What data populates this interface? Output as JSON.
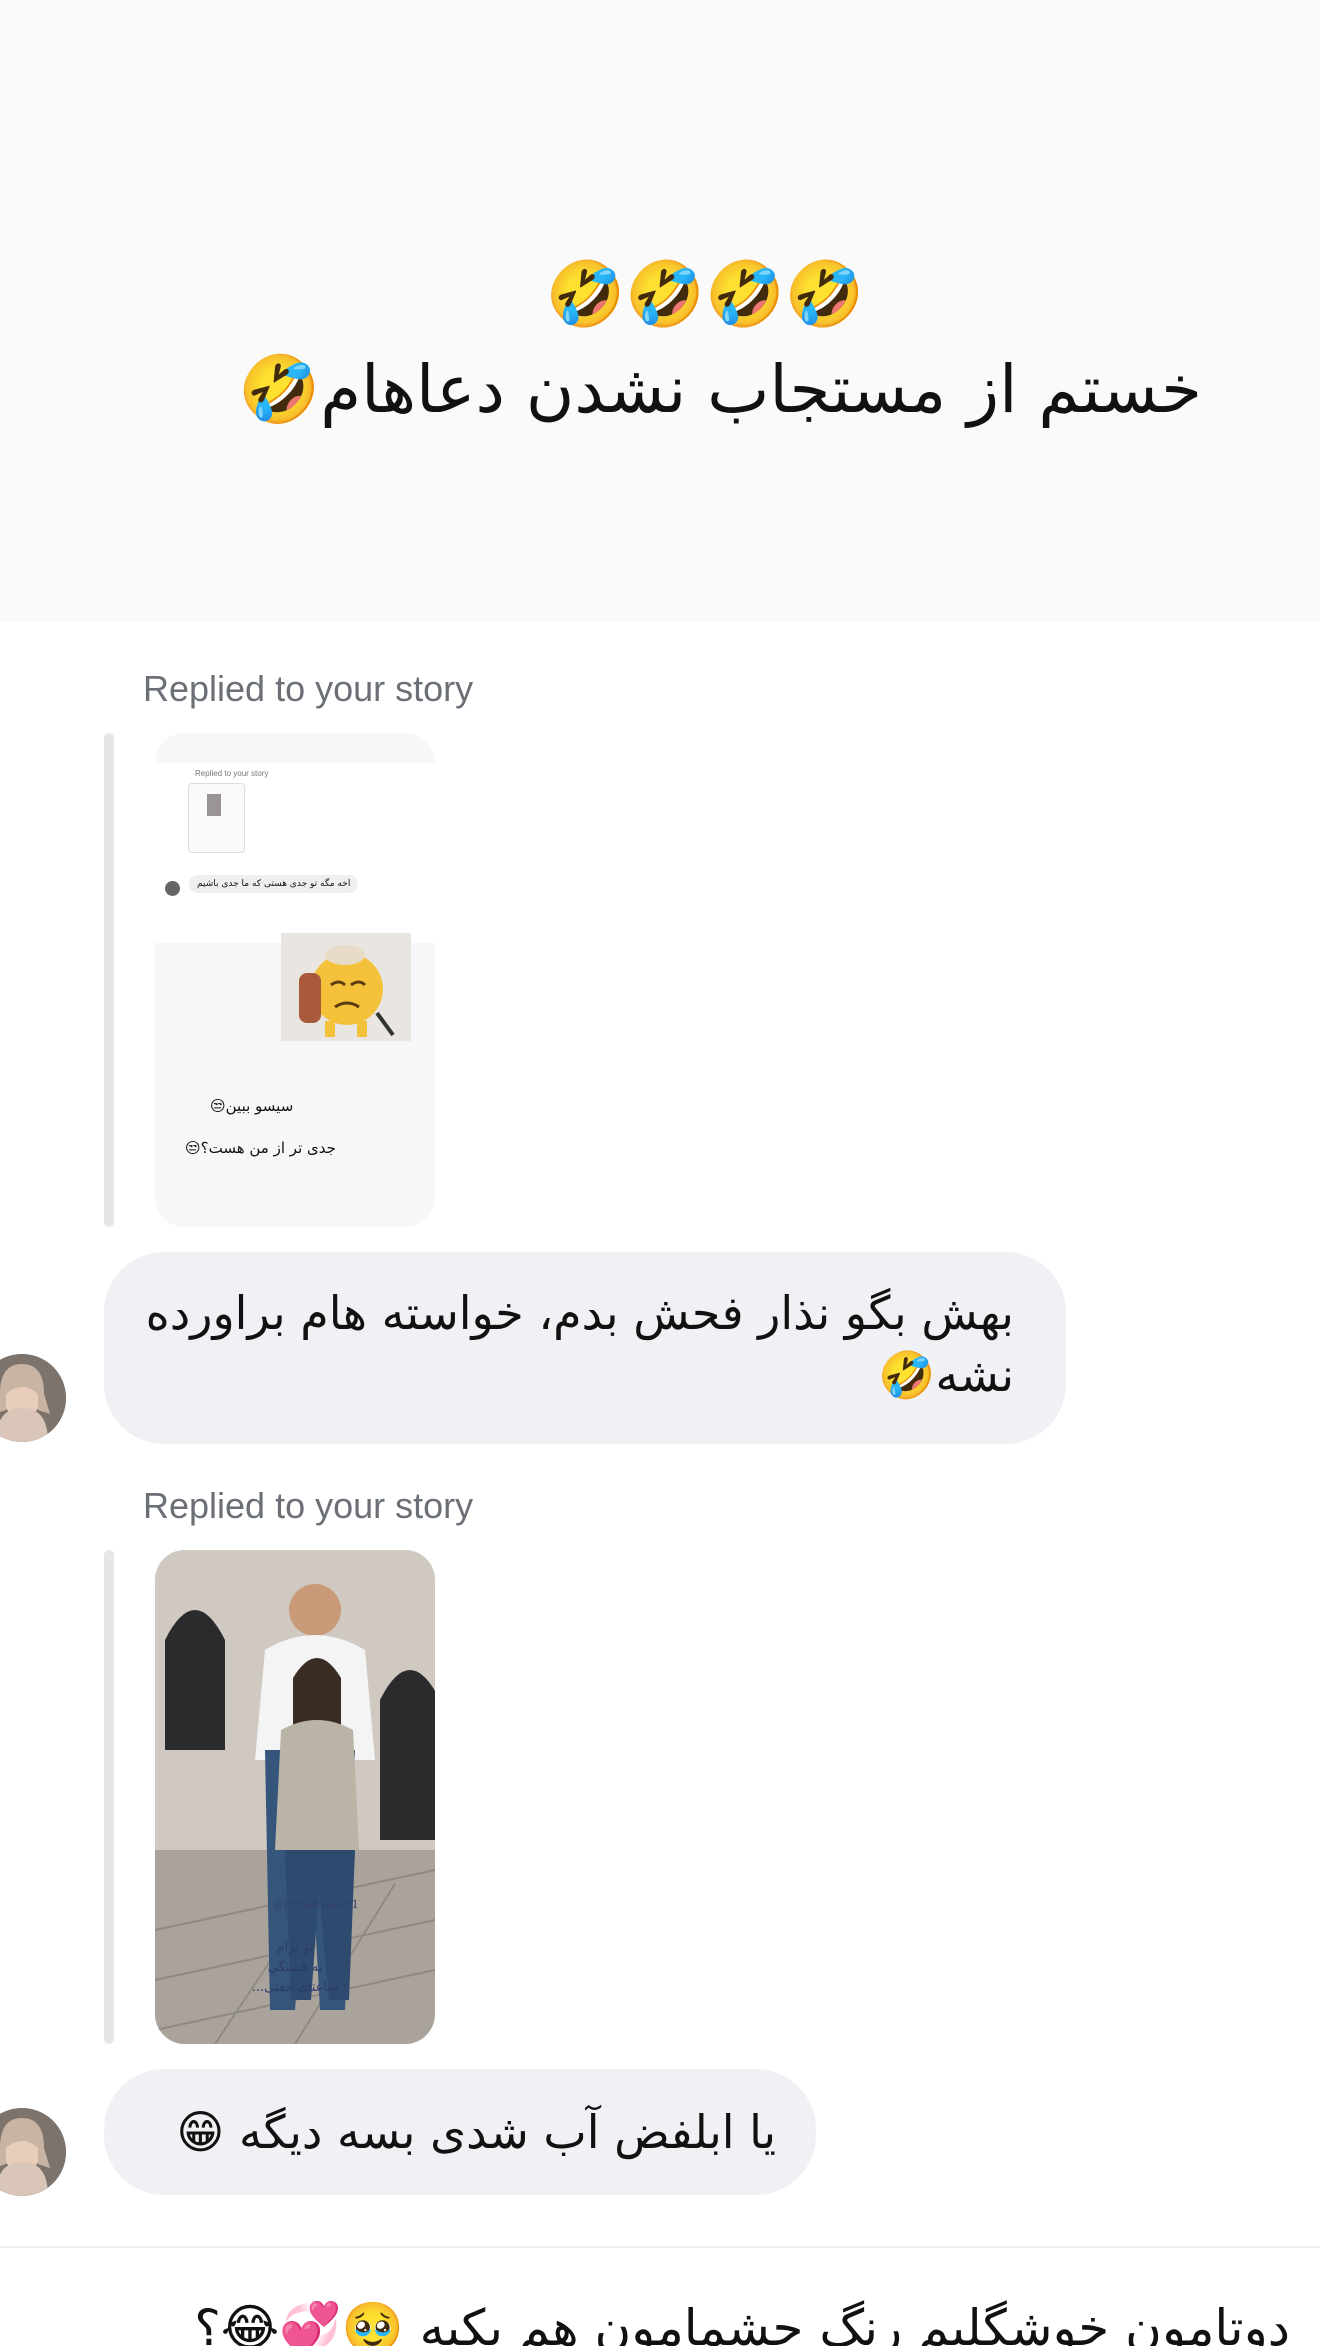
{
  "story": {
    "emojis": "🤣🤣🤣🤣",
    "caption": "خستم از مستجاب نشدن دعاهام🤣"
  },
  "replies": [
    {
      "label": "Replied to your story",
      "thumb": {
        "inner_label": "Replied to your story",
        "inner_message": "اخه مگه تو جدی هستی که ما جدی باشیم",
        "inner_caption_1": "سیسو ببین😒",
        "inner_caption_2": "جدی تر از من هست؟😒"
      },
      "message": "بهش بگو نذار فحش بدم، خواسته هام براورده نشه🤣"
    },
    {
      "label": "Replied to your story",
      "thumb": {
        "handle": "@primetrader1",
        "caption_1": "تو برام",
        "caption_2": "به قشنگیِ",
        "caption_3": "ساعتای جفتی..."
      },
      "message": "یا ابلفض آب شدی بسه دیگه 😁"
    }
  ],
  "next_message_peek": "دوتامون خوشگلیم رنگ چشمامون هم یکیه 🥹💞😂؟"
}
